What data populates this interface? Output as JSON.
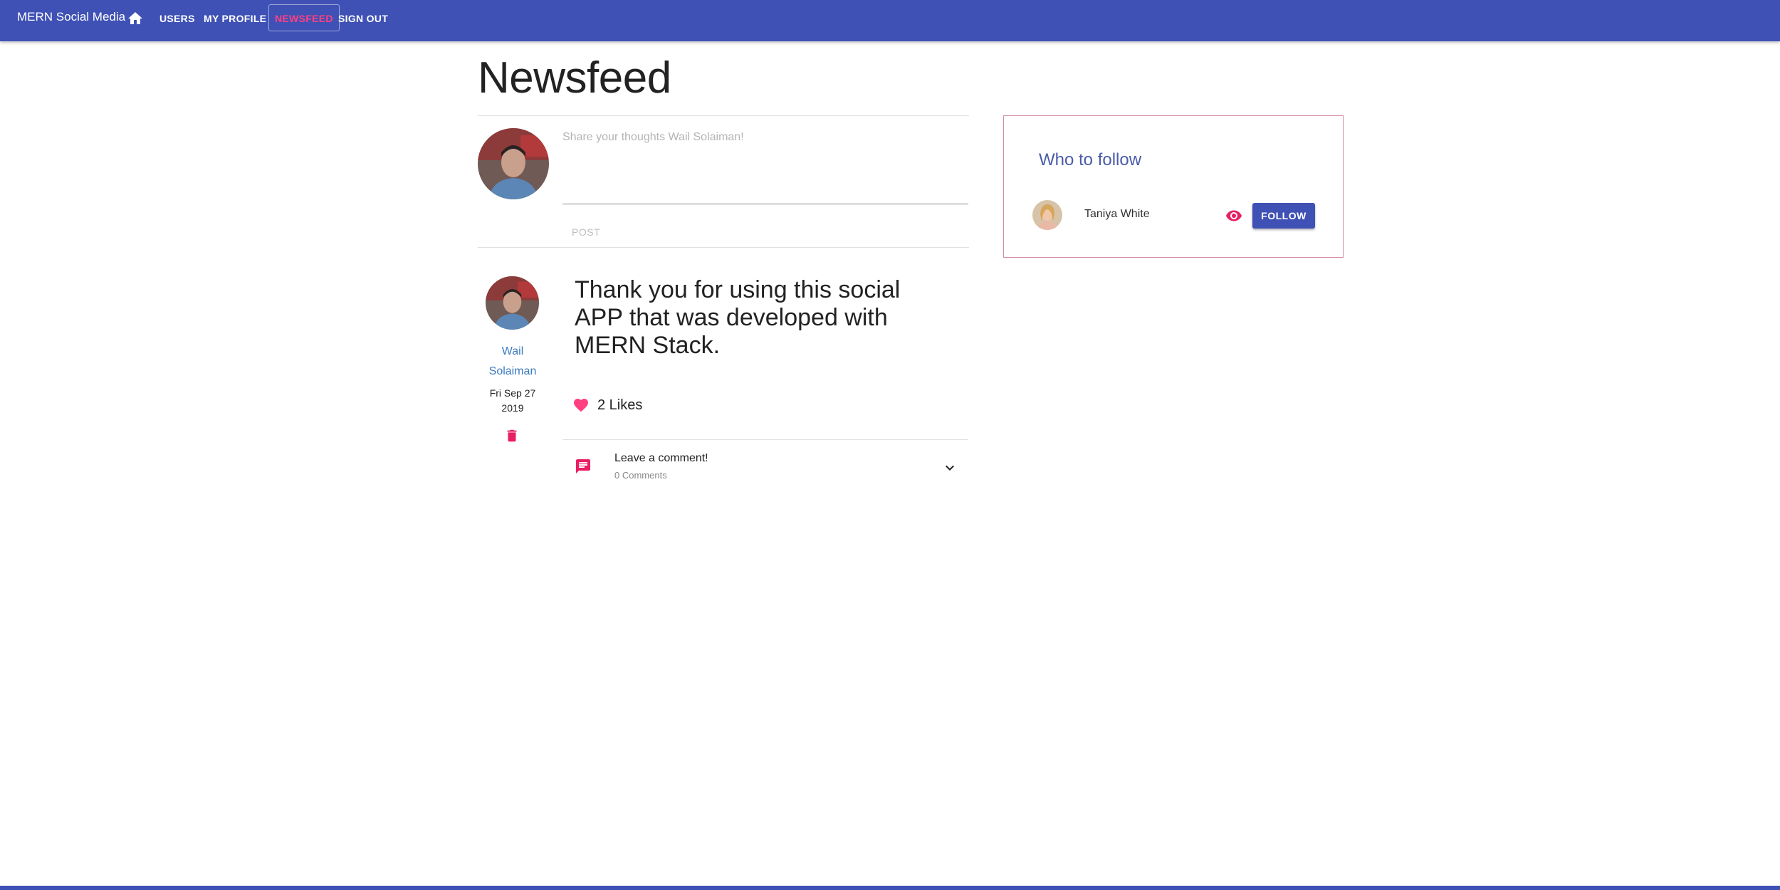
{
  "appbar": {
    "brand": "MERN Social Media",
    "nav": [
      "USERS",
      "MY PROFILE",
      "NEWSFEED",
      "SIGN OUT"
    ],
    "active": "NEWSFEED"
  },
  "page": {
    "title": "Newsfeed"
  },
  "composer": {
    "placeholder": "Share your thoughts Wail Solaiman!",
    "post_label": "POST"
  },
  "post": {
    "author_line1": "Wail",
    "author_line2": "Solaiman",
    "date_line1": "Fri Sep 27",
    "date_line2": "2019",
    "text": "Thank you for using this social APP that was developed with MERN Stack.",
    "likes": "2 Likes",
    "comment_title": "Leave a comment!",
    "comment_count": "0 Comments"
  },
  "who_to_follow": {
    "title": "Who to follow",
    "users": [
      {
        "name": "Taniya White",
        "follow_label": "FOLLOW"
      }
    ]
  },
  "colors": {
    "primary": "#3f51b5",
    "accent": "#ff4081",
    "link": "#3a7bbf"
  }
}
